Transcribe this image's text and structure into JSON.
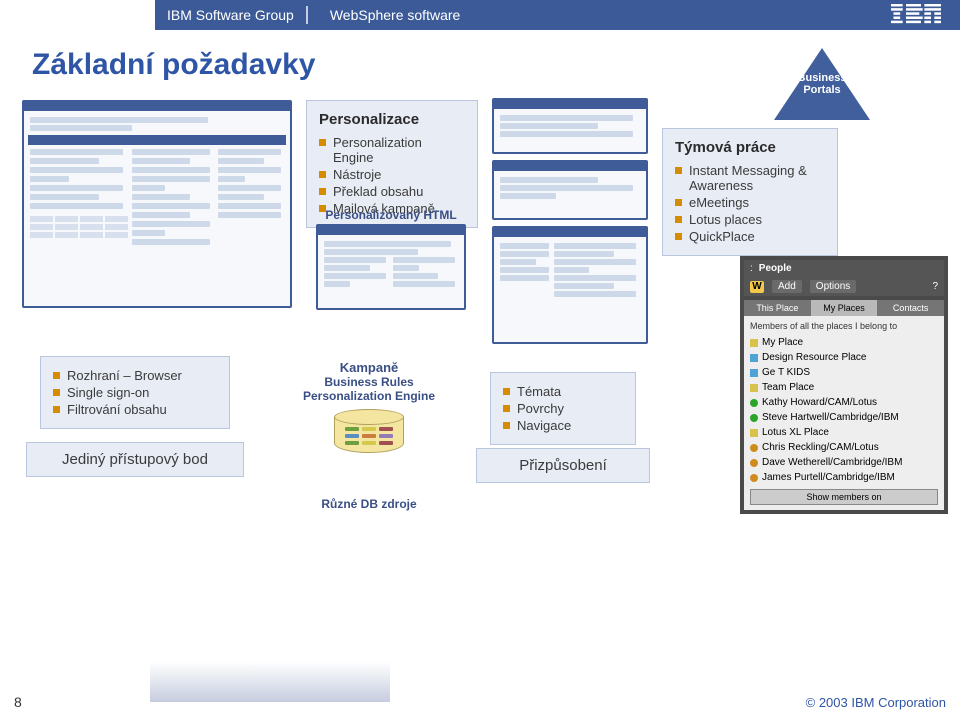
{
  "header": {
    "group": "IBM Software Group",
    "product": "WebSphere software",
    "logo_alt": "IBM"
  },
  "title": "Základní požadavky",
  "triangle": {
    "line1": "Business",
    "line2": "Portals"
  },
  "personalization": {
    "title": "Personalizace",
    "items": [
      "Personalization Engine",
      "Nástroje",
      "Překlad obsahu",
      "Mailová kampaně"
    ],
    "caption": "Personalizovaný HTML"
  },
  "teamwork": {
    "title": "Týmová práce",
    "items": [
      "Instant Messaging & Awareness",
      "eMeetings",
      "Lotus places",
      "QuickPlace"
    ]
  },
  "interface": {
    "items": [
      "Rozhraní – Browser",
      "Single sign-on",
      "Filtrování obsahu"
    ],
    "access": "Jediný přístupový bod"
  },
  "campaigns": {
    "title": "Kampaně",
    "lines": [
      "Business Rules",
      "Personalization Engine"
    ],
    "db_caption": "Různé DB zdroje"
  },
  "customization": {
    "items": [
      "Témata",
      "Povrchy",
      "Navigace"
    ],
    "label": "Přizpůsobení"
  },
  "people": {
    "header": "People",
    "add": "Add",
    "options": "Options",
    "tabs": [
      "This Place",
      "My Places",
      "Contacts"
    ],
    "desc": "Members of all the places I belong to",
    "groups": [
      {
        "icon": "square",
        "color": "#d9c24b",
        "label": "My Place"
      },
      {
        "icon": "square",
        "color": "#4fa3d4",
        "label": "Design Resource Place"
      },
      {
        "icon": "square",
        "color": "#4fa3d4",
        "label": "Ge T KIDS"
      },
      {
        "icon": "square",
        "color": "#d9c24b",
        "label": "Team Place"
      },
      {
        "icon": "dot",
        "color": "#2aa52a",
        "label": "Kathy Howard/CAM/Lotus"
      },
      {
        "icon": "dot",
        "color": "#2aa52a",
        "label": "Steve Hartwell/Cambridge/IBM"
      },
      {
        "icon": "square",
        "color": "#d9c24b",
        "label": "Lotus XL Place"
      },
      {
        "icon": "dot",
        "color": "#d08a1e",
        "label": "Chris Reckling/CAM/Lotus"
      },
      {
        "icon": "dot",
        "color": "#d08a1e",
        "label": "Dave Wetherell/Cambridge/IBM"
      },
      {
        "icon": "dot",
        "color": "#d08a1e",
        "label": "James Purtell/Cambridge/IBM"
      }
    ],
    "button": "Show members on"
  },
  "footer": {
    "page": "8",
    "copyright": "© 2003 IBM Corporation"
  }
}
